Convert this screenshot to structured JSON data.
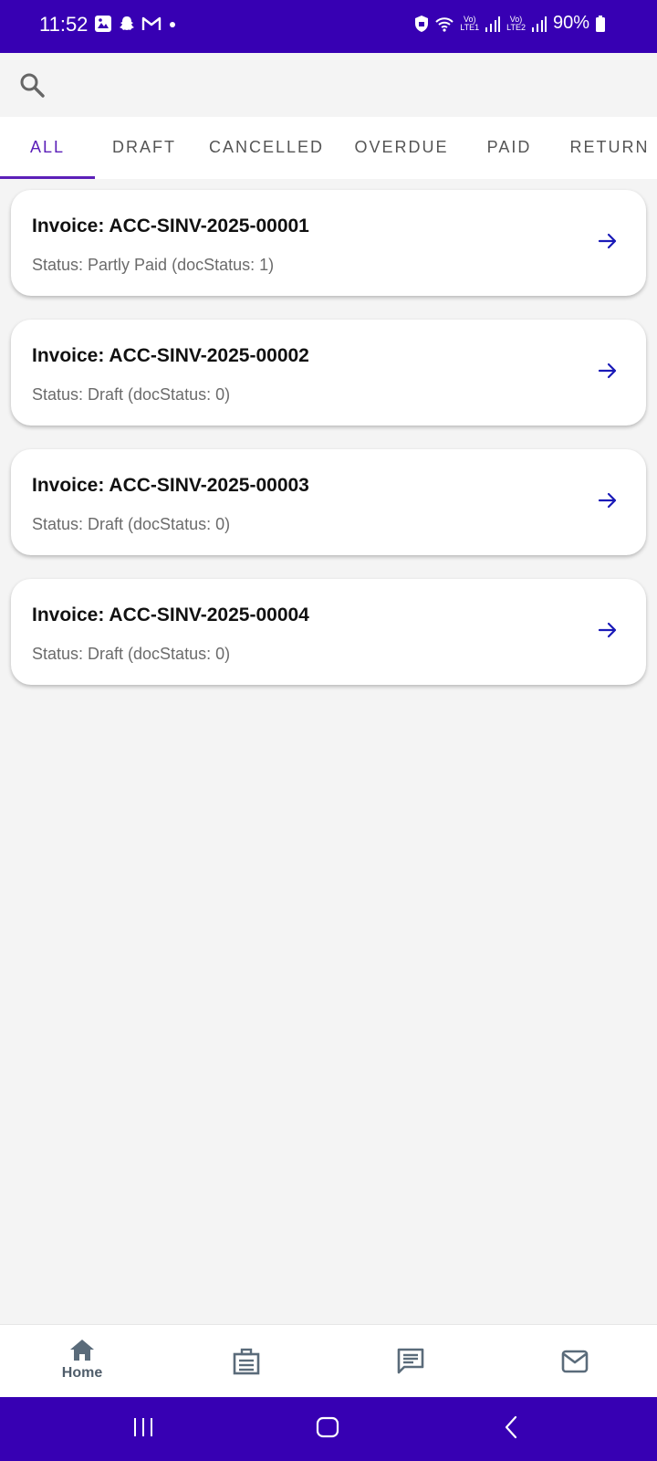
{
  "status_bar": {
    "time": "11:52",
    "battery": "90%",
    "sim1_label": "LTE1",
    "sim2_label": "LTE2",
    "left_icons": [
      "gallery-icon",
      "snapchat-icon",
      "gmail-icon",
      "dot-icon"
    ],
    "right_icons": [
      "secure-folder-icon",
      "wifi-icon",
      "signal-icon",
      "battery-icon"
    ]
  },
  "search": {
    "icon": "search-icon"
  },
  "tabs": [
    {
      "label": "ALL",
      "active": true
    },
    {
      "label": "DRAFT",
      "active": false
    },
    {
      "label": "CANCELLED",
      "active": false
    },
    {
      "label": "OVERDUE",
      "active": false
    },
    {
      "label": "PAID",
      "active": false
    },
    {
      "label": "RETURN",
      "active": false
    }
  ],
  "invoices": [
    {
      "title": "Invoice: ACC-SINV-2025-00001",
      "status": "Status: Partly Paid (docStatus: 1)"
    },
    {
      "title": "Invoice: ACC-SINV-2025-00002",
      "status": "Status: Draft (docStatus: 0)"
    },
    {
      "title": "Invoice: ACC-SINV-2025-00003",
      "status": "Status: Draft (docStatus: 0)"
    },
    {
      "title": "Invoice: ACC-SINV-2025-00004",
      "status": "Status: Draft (docStatus: 0)"
    }
  ],
  "bottom_nav": {
    "home_label": "Home",
    "items": [
      "home-icon",
      "briefcase-icon",
      "chat-icon",
      "mail-icon"
    ]
  },
  "colors": {
    "status_bar": "#3700b3",
    "accent": "#5b1fb8",
    "arrow": "#1a1ab8",
    "nav_icon": "#5a6b7a"
  }
}
